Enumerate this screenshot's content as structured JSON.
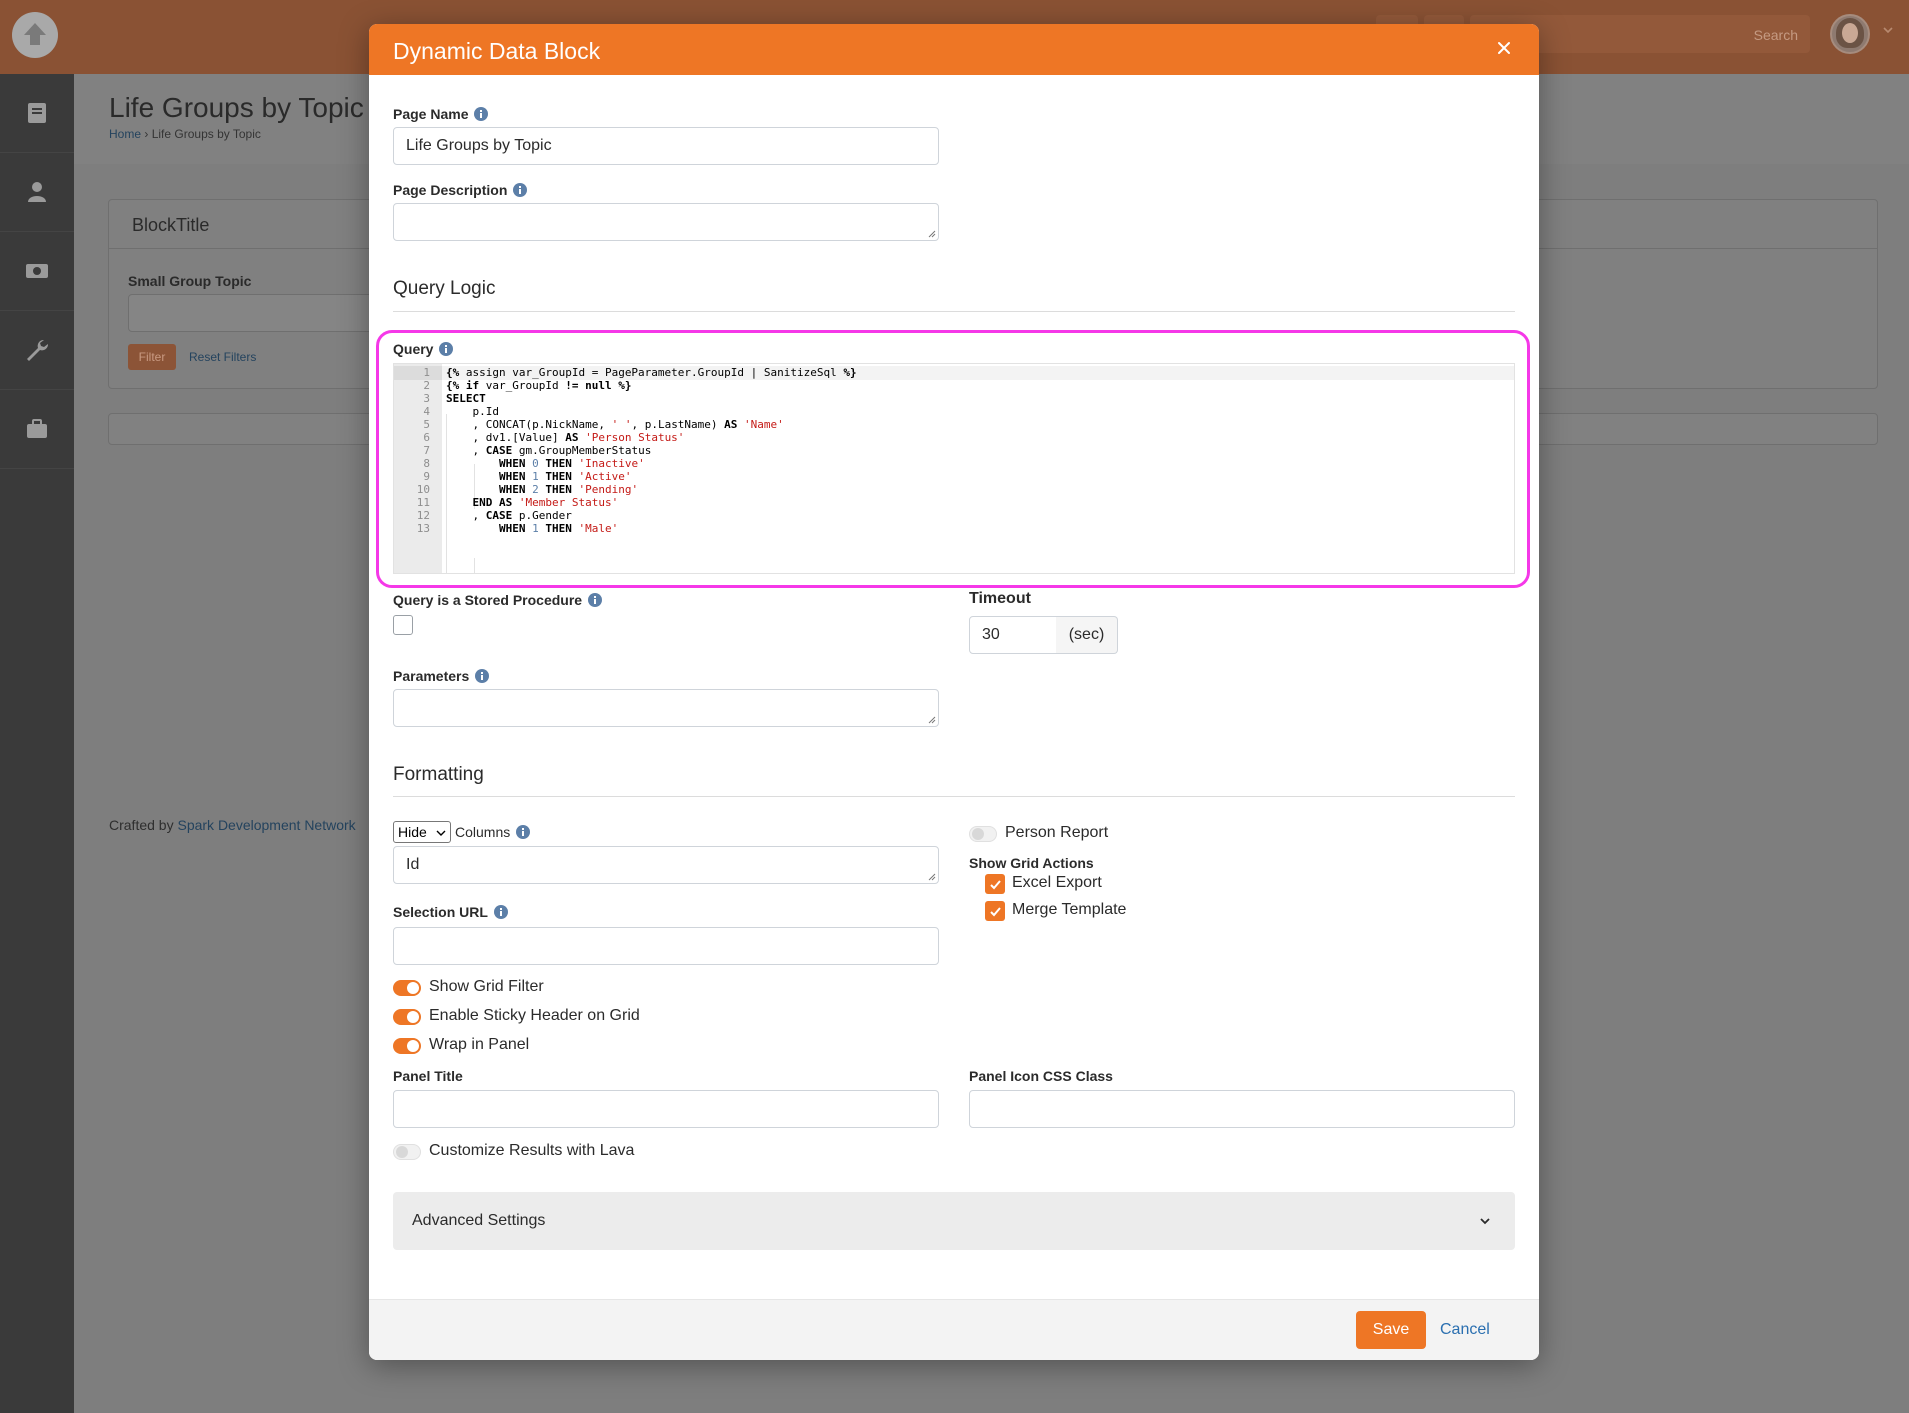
{
  "app": {
    "search_label": "Search",
    "background": {
      "page_title": "Life Groups by Topic",
      "breadcrumb_home": "Home",
      "breadcrumb_sep": "›",
      "breadcrumb_current": "Life Groups by Topic",
      "block_title": "BlockTitle",
      "filter_label": "Small Group Topic",
      "filter_button": "Filter",
      "reset_filters": "Reset Filters",
      "crafted_prefix": "Crafted by ",
      "crafted_link": "Spark Development Network"
    },
    "sidebar_icons": [
      "book-icon",
      "person-icon",
      "money-icon",
      "wrench-icon",
      "briefcase-icon"
    ]
  },
  "modal": {
    "title": "Dynamic Data Block",
    "page_name_label": "Page Name",
    "page_name_value": "Life Groups by Topic",
    "page_description_label": "Page Description",
    "page_description_value": "",
    "query_logic_title": "Query Logic",
    "query_label": "Query",
    "query_lines": [
      "{% assign var_GroupId = PageParameter.GroupId | SanitizeSql %}",
      "{% if var_GroupId != null %}",
      "SELECT",
      "    p.Id",
      "    , CONCAT(p.NickName, ' ', p.LastName) AS 'Name'",
      "    , dv1.[Value] AS 'Person Status'",
      "    , CASE gm.GroupMemberStatus",
      "        WHEN 0 THEN 'Inactive'",
      "        WHEN 1 THEN 'Active'",
      "        WHEN 2 THEN 'Pending'",
      "    END AS 'Member Status'",
      "    , CASE p.Gender",
      "        WHEN 1 THEN 'Male'"
    ],
    "stored_procedure_label": "Query is a Stored Procedure",
    "stored_procedure_checked": false,
    "timeout_label": "Timeout",
    "timeout_value": "30",
    "timeout_unit": "(sec)",
    "parameters_label": "Parameters",
    "parameters_value": "",
    "formatting_title": "Formatting",
    "hide_select_value": "Hide",
    "columns_label": "Columns",
    "columns_value": "Id",
    "selection_url_label": "Selection URL",
    "selection_url_value": "",
    "person_report_label": "Person Report",
    "person_report_on": false,
    "show_grid_actions_label": "Show Grid Actions",
    "excel_export_label": "Excel Export",
    "excel_export_checked": true,
    "merge_template_label": "Merge Template",
    "merge_template_checked": true,
    "show_grid_filter_label": "Show Grid Filter",
    "show_grid_filter_on": true,
    "sticky_header_label": "Enable Sticky Header on Grid",
    "sticky_header_on": true,
    "wrap_panel_label": "Wrap in Panel",
    "wrap_panel_on": true,
    "panel_title_label": "Panel Title",
    "panel_title_value": "",
    "panel_icon_label": "Panel Icon CSS Class",
    "panel_icon_value": "",
    "customize_lava_label": "Customize Results with Lava",
    "customize_lava_on": false,
    "advanced_settings_label": "Advanced Settings",
    "save_label": "Save",
    "cancel_label": "Cancel"
  },
  "colors": {
    "accent": "#ee7625",
    "highlight": "#f538e8",
    "link": "#2a6fb0",
    "keyword": "#000000",
    "string": "#c41a16",
    "number": "#5c7fa8"
  }
}
